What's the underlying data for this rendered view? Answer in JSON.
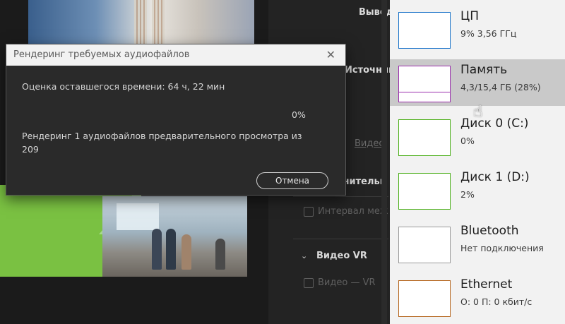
{
  "dialog": {
    "title": "Рендеринг требуемых аудиофайлов",
    "close_symbol": "✕",
    "estimate": "Оценка оставшегося времени: 64 ч, 22 мин",
    "progress_percent": "0%",
    "files": "Рендеринг 1 аудиофайлов предварительного просмотра из 209",
    "cancel_label": "Отмена"
  },
  "editor_panel": {
    "output_label": "Вывод",
    "source_label": "Источник",
    "video_tab": "Видео",
    "additional_label": "лнительн",
    "interval_checkbox": "Интервал меж",
    "vr_section": "Видео VR",
    "vr_checkbox": "Видео — VR"
  },
  "task_manager": {
    "items": [
      {
        "title": "ЦП",
        "sub": "9% 3,56 ГГц",
        "color": "#1a73c9"
      },
      {
        "title": "Память",
        "sub": "4,3/15,4 ГБ (28%)",
        "color": "#9b2fae"
      },
      {
        "title": "Диск 0 (C:)",
        "sub": "0%",
        "color": "#4caf1a"
      },
      {
        "title": "Диск 1 (D:)",
        "sub": "2%",
        "color": "#4caf1a"
      },
      {
        "title": "Bluetooth",
        "sub": "Нет подключения",
        "color": "#9a9a9a"
      },
      {
        "title": "Ethernet",
        "sub": "О: 0 П: 0 кбит/с",
        "color": "#b5651d"
      }
    ],
    "selected_index": 1
  }
}
